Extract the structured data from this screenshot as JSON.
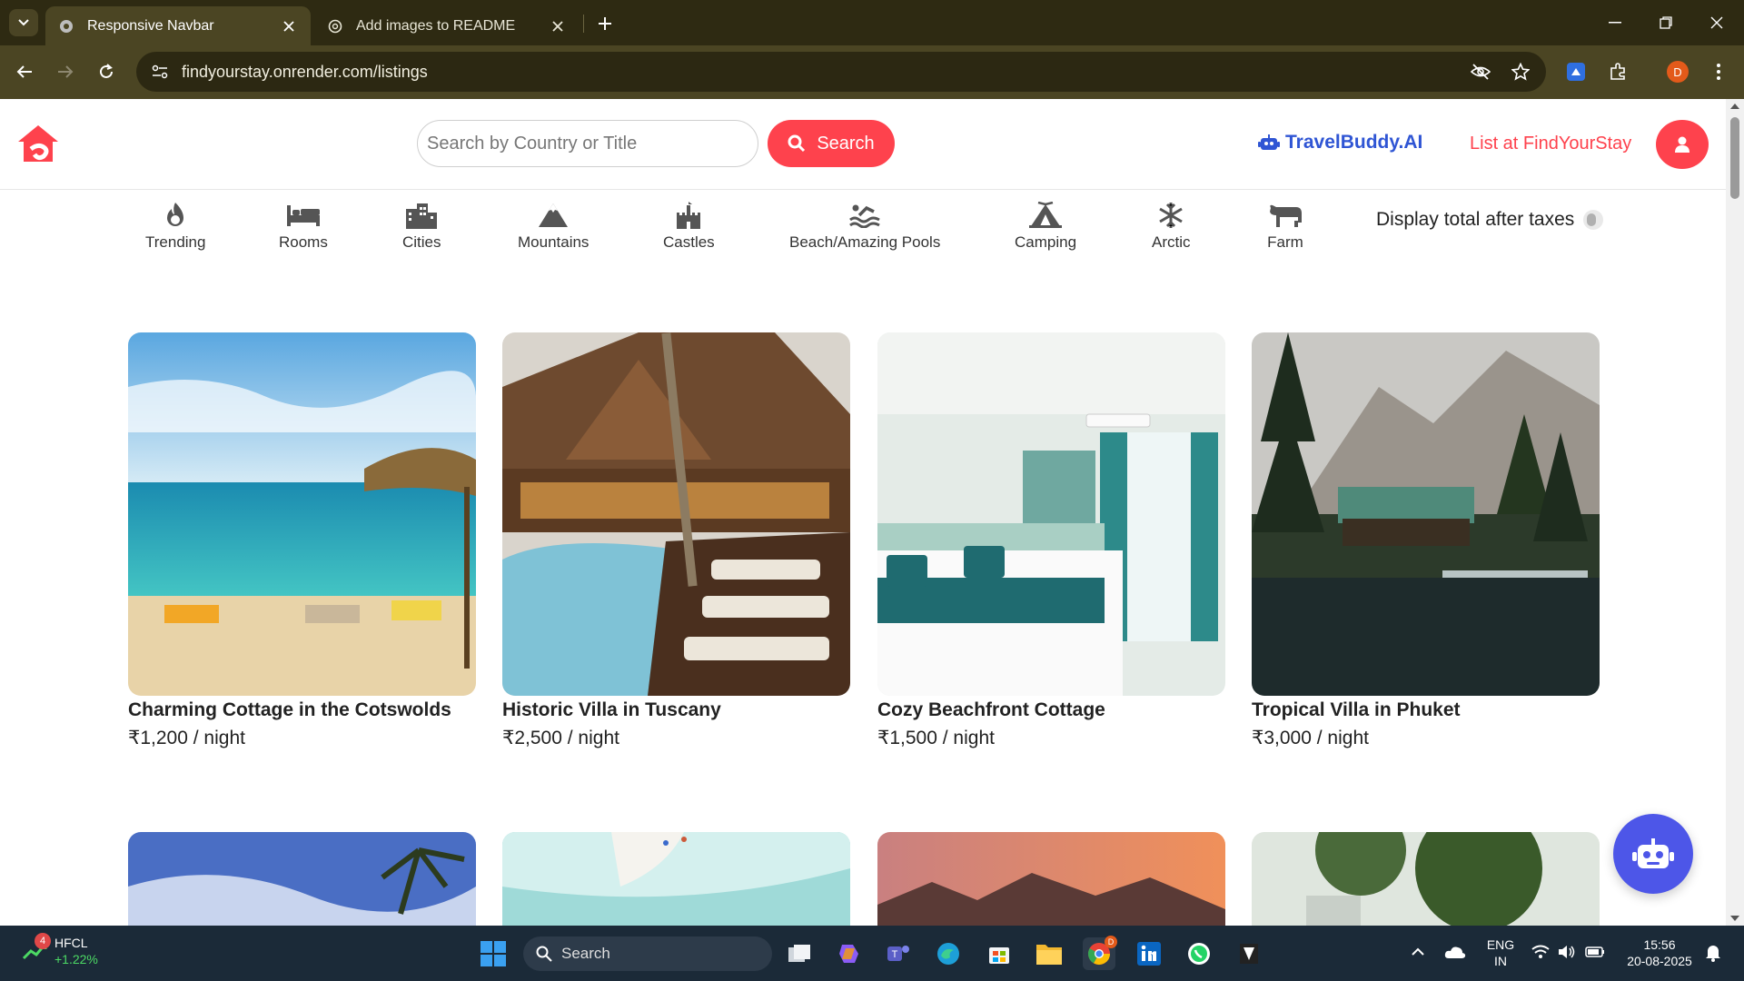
{
  "browser": {
    "tabs": [
      {
        "title": "Responsive Navbar",
        "active": true
      },
      {
        "title": "Add images to README",
        "active": false
      }
    ],
    "url": "findyourstay.onrender.com/listings",
    "profile_initial": "D"
  },
  "navbar": {
    "search_placeholder": "Search by Country or Title",
    "search_button": "Search",
    "travelbuddy_label": "TravelBuddy.AI",
    "list_label": "List at FindYourStay",
    "brand_color": "#fe424d"
  },
  "filters": [
    {
      "label": "Trending",
      "icon": "fire-icon"
    },
    {
      "label": "Rooms",
      "icon": "bed-icon"
    },
    {
      "label": "Cities",
      "icon": "city-icon"
    },
    {
      "label": "Mountains",
      "icon": "mountain-icon"
    },
    {
      "label": "Castles",
      "icon": "castle-icon"
    },
    {
      "label": "Beach/Amazing Pools",
      "icon": "pool-icon"
    },
    {
      "label": "Camping",
      "icon": "tent-icon"
    },
    {
      "label": "Arctic",
      "icon": "snowflake-icon"
    },
    {
      "label": "Farm",
      "icon": "cow-icon"
    }
  ],
  "tax_toggle_label": "Display total after taxes",
  "listings": [
    {
      "title": "Charming Cottage in the Cotswolds",
      "price": "₹1,200 / night"
    },
    {
      "title": "Historic Villa in Tuscany",
      "price": "₹2,500 / night"
    },
    {
      "title": "Cozy Beachfront Cottage",
      "price": "₹1,500 / night"
    },
    {
      "title": "Tropical Villa in Phuket",
      "price": "₹3,000 / night"
    }
  ],
  "taskbar": {
    "stock_name": "HFCL",
    "stock_change": "+1.22%",
    "stock_badge": "4",
    "search_label": "Search",
    "lang_1": "ENG",
    "lang_2": "IN",
    "time": "15:56",
    "date": "20-08-2025",
    "chrome_badge": "D"
  }
}
